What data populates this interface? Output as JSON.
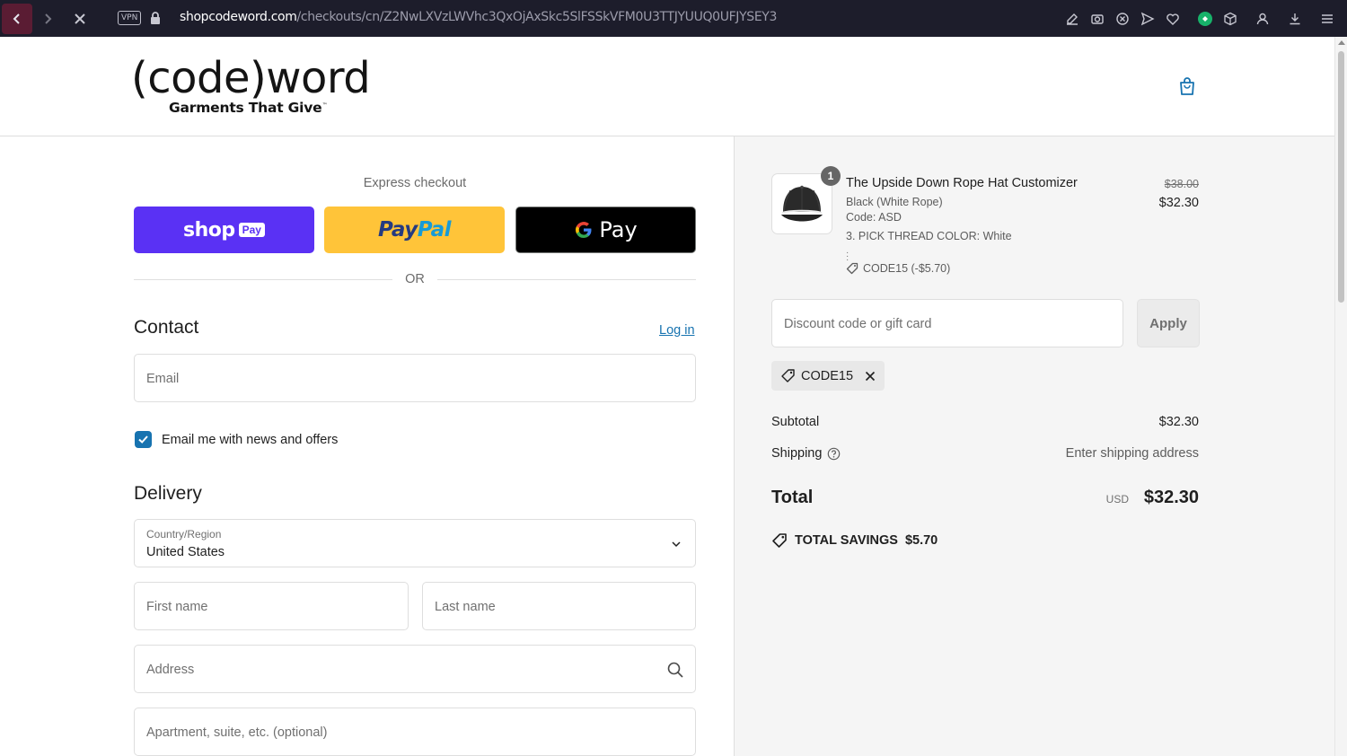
{
  "browser": {
    "vpn_label": "VPN",
    "url_host": "shopcodeword.com",
    "url_path": "/checkouts/cn/Z2NwLXVzLWVhc3QxOjAxSkc5SlFSSkVFM0U3TTJYUUQ0UFJYSEY3"
  },
  "header": {
    "logo_main": "(code)word",
    "logo_sub": "Garments That Give",
    "logo_tm": "™"
  },
  "checkout": {
    "express_label": "Express checkout",
    "shoppay": {
      "word": "shop",
      "pay": "Pay"
    },
    "paypal": {
      "part1": "Pay",
      "part2": "Pal"
    },
    "gpay": {
      "word": "Pay"
    },
    "or_label": "OR",
    "contact": {
      "title": "Contact",
      "login_link": "Log in",
      "email_placeholder": "Email",
      "newsletter_label": "Email me with news and offers",
      "newsletter_checked": true
    },
    "delivery": {
      "title": "Delivery",
      "country_label": "Country/Region",
      "country_value": "United States",
      "first_name_placeholder": "First name",
      "last_name_placeholder": "Last name",
      "address_placeholder": "Address",
      "apartment_placeholder": "Apartment, suite, etc. (optional)"
    }
  },
  "summary": {
    "item": {
      "quantity": "1",
      "title": "The Upside Down Rope Hat Customizer",
      "variant": "Black (White Rope)",
      "code": "Code: ASD",
      "thread": "3. PICK THREAD COLOR: White",
      "discount_line": "CODE15 (-$5.70)",
      "compare_price": "$38.00",
      "price": "$32.30"
    },
    "discount_placeholder": "Discount code or gift card",
    "apply_label": "Apply",
    "applied_code": "CODE15",
    "subtotal_label": "Subtotal",
    "subtotal_value": "$32.30",
    "shipping_label": "Shipping",
    "shipping_value": "Enter shipping address",
    "total_label": "Total",
    "total_currency": "USD",
    "total_value": "$32.30",
    "savings_label": "TOTAL SAVINGS",
    "savings_value": "$5.70"
  },
  "colors": {
    "accent": "#1773b0",
    "shoppay": "#5a31f4",
    "paypal": "#ffc439",
    "browser_bar": "#1d1d2b"
  }
}
